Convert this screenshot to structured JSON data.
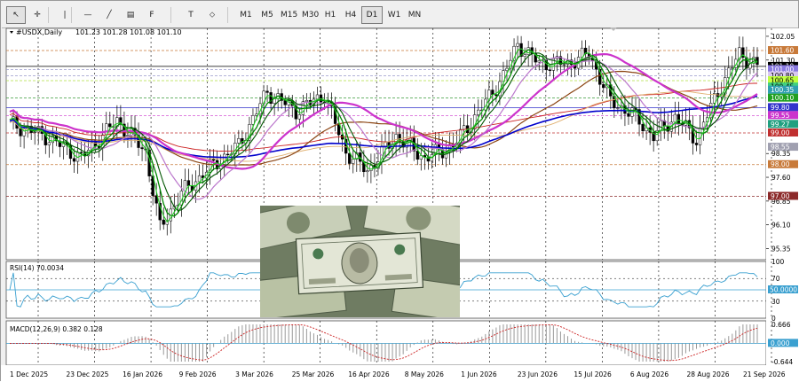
{
  "toolbar": {
    "tools": [
      {
        "name": "cursor-icon",
        "glyph": "↖",
        "active": true
      },
      {
        "name": "crosshair-icon",
        "glyph": "✛"
      },
      {
        "name": "vertical-line-icon",
        "glyph": "|"
      },
      {
        "name": "horizontal-line-icon",
        "glyph": "—"
      },
      {
        "name": "trendline-icon",
        "glyph": "╱"
      },
      {
        "name": "channel-icon",
        "glyph": "▤"
      },
      {
        "name": "fibonacci-icon",
        "glyph": "F"
      },
      {
        "name": "text-icon",
        "glyph": "T"
      },
      {
        "name": "shapes-icon",
        "glyph": "⬦"
      }
    ],
    "timeframes": [
      "M1",
      "M5",
      "M15",
      "M30",
      "H1",
      "H4",
      "D1",
      "W1",
      "MN"
    ],
    "active_timeframe": "D1"
  },
  "chart": {
    "header_symbol": "#USDX,Daily",
    "header_ohlc": "101.23 101.28 101.08 101.10",
    "colors": {
      "background": "#ffffff",
      "bull": "#ffffff",
      "bear": "#000000",
      "grid": "#000000",
      "hline_orange": "#c87a3a",
      "hline_purple": "#9999cc",
      "hline_green": "#3a9a3a",
      "hline_blue": "#3333cc",
      "hline_red": "#c03030",
      "ma_purple": "#cc33cc",
      "ma_blue": "#0000cc",
      "ma_brown": "#8b4513",
      "ma_tan": "#e0b070",
      "ma_green1": "#008800",
      "ma_green2": "#22cc22",
      "ma_darkgreen": "#005500",
      "ma_lilac": "#bb77cc",
      "ma_red": "#cc2222",
      "rsi_line": "#3aa0d0",
      "macd_signal": "#cc2222",
      "macd_hist": "#999999"
    },
    "price_axis": {
      "min": 95.0,
      "max": 102.3,
      "ticks": [
        "102.05",
        "101.30",
        "98.35",
        "97.60",
        "96.85",
        "96.10",
        "95.35"
      ]
    },
    "price_tags": [
      {
        "label": "101.60",
        "value": 101.6,
        "bg": "#c87a3a",
        "fg": "#ffffff"
      },
      {
        "label": "101.10",
        "value": 101.1,
        "bg": "#000000",
        "fg": "#ffffff"
      },
      {
        "label": "101.00",
        "value": 101.0,
        "bg": "#8a7ae0",
        "fg": "#ffffff"
      },
      {
        "label": "100.80",
        "value": 100.8,
        "bg": "#d8c8f0",
        "fg": "#000000"
      },
      {
        "label": "100.65",
        "value": 100.65,
        "bg": "#c0ff40",
        "fg": "#000000"
      },
      {
        "label": "100.45",
        "value": 100.45,
        "bg": "#40d080",
        "fg": "#000000"
      },
      {
        "label": "100.35",
        "value": 100.35,
        "bg": "#30a0b0",
        "fg": "#ffffff"
      },
      {
        "label": "100.10",
        "value": 100.1,
        "bg": "#20a020",
        "fg": "#ffffff"
      },
      {
        "label": "99.80",
        "value": 99.8,
        "bg": "#3333cc",
        "fg": "#ffffff"
      },
      {
        "label": "99.55",
        "value": 99.55,
        "bg": "#cc33cc",
        "fg": "#ffffff"
      },
      {
        "label": "99.27",
        "value": 99.27,
        "bg": "#20a080",
        "fg": "#ffffff"
      },
      {
        "label": "99.00",
        "value": 99.0,
        "bg": "#c03030",
        "fg": "#ffffff"
      },
      {
        "label": "98.55",
        "value": 98.55,
        "bg": "#a0a0b0",
        "fg": "#ffffff"
      },
      {
        "label": "98.00",
        "value": 98.0,
        "bg": "#c87a3a",
        "fg": "#ffffff"
      },
      {
        "label": "97.00",
        "value": 97.0,
        "bg": "#8b2a2a",
        "fg": "#ffffff"
      }
    ],
    "rsi": {
      "label": "RSI(14) 70.0034",
      "axis_labels": [
        "100",
        "70",
        "50.0000",
        "30",
        "0"
      ],
      "level_label": "50.0000"
    },
    "macd": {
      "label": "MACD(12,26,9) 0.382 0.128",
      "axis_labels": [
        "0.666",
        "0.000",
        "-0.644"
      ],
      "zero_label": "0.000"
    },
    "date_labels": [
      "1 Dec 2025",
      "23 Dec 2025",
      "16 Jan 2026",
      "9 Feb 2026",
      "3 Mar 2026",
      "25 Mar 2026",
      "16 Apr 2026",
      "8 May 2026",
      "1 Jun 2026",
      "23 Jun 2026",
      "15 Jul 2026",
      "6 Aug 2026",
      "28 Aug 2026",
      "21 Sep 2026"
    ]
  }
}
